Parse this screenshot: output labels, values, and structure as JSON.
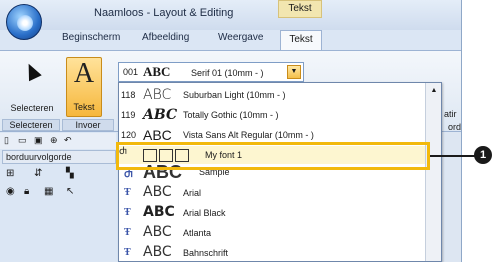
{
  "window": {
    "title": "Naamloos - Layout & Editing",
    "context_tab": "Tekst"
  },
  "tabs": [
    "Beginscherm",
    "Afbeelding",
    "Weergave",
    "Tekst"
  ],
  "ribbon": {
    "select_label": "Selecteren",
    "text_label": "Tekst",
    "group_select": "Selecteren",
    "group_insert": "Invoer",
    "fragment_a": "atir",
    "fragment_b": "ord"
  },
  "font_combo": {
    "code": "001",
    "abc": "ABC",
    "name": "Serif 01  (10mm - )"
  },
  "panel": {
    "title": "borduurvolgorde"
  },
  "font_list": [
    {
      "code": "118",
      "abc": "ABC",
      "name": "Suburban Light  (10mm - )"
    },
    {
      "code": "119",
      "abc": "ABC",
      "name": "Totally Gothic  (10mm - )"
    },
    {
      "code": "120",
      "abc": "ABC",
      "name": "Vista Sans Alt Regular  (10mm - )"
    },
    {
      "code": "",
      "abc": "",
      "name": "My font 1"
    },
    {
      "code": "",
      "abc": "ABC",
      "name": "Sample"
    },
    {
      "code": "",
      "abc": "ABC",
      "name": "Arial"
    },
    {
      "code": "",
      "abc": "ABC",
      "name": "Arial Black"
    },
    {
      "code": "",
      "abc": "ABC",
      "name": "Atlanta"
    },
    {
      "code": "",
      "abc": "ABC",
      "name": "Bahnschrift"
    }
  ],
  "callout": {
    "number": "1"
  },
  "colors": {
    "highlight_border": "#f2b90c",
    "accent": "#f6b73c"
  }
}
